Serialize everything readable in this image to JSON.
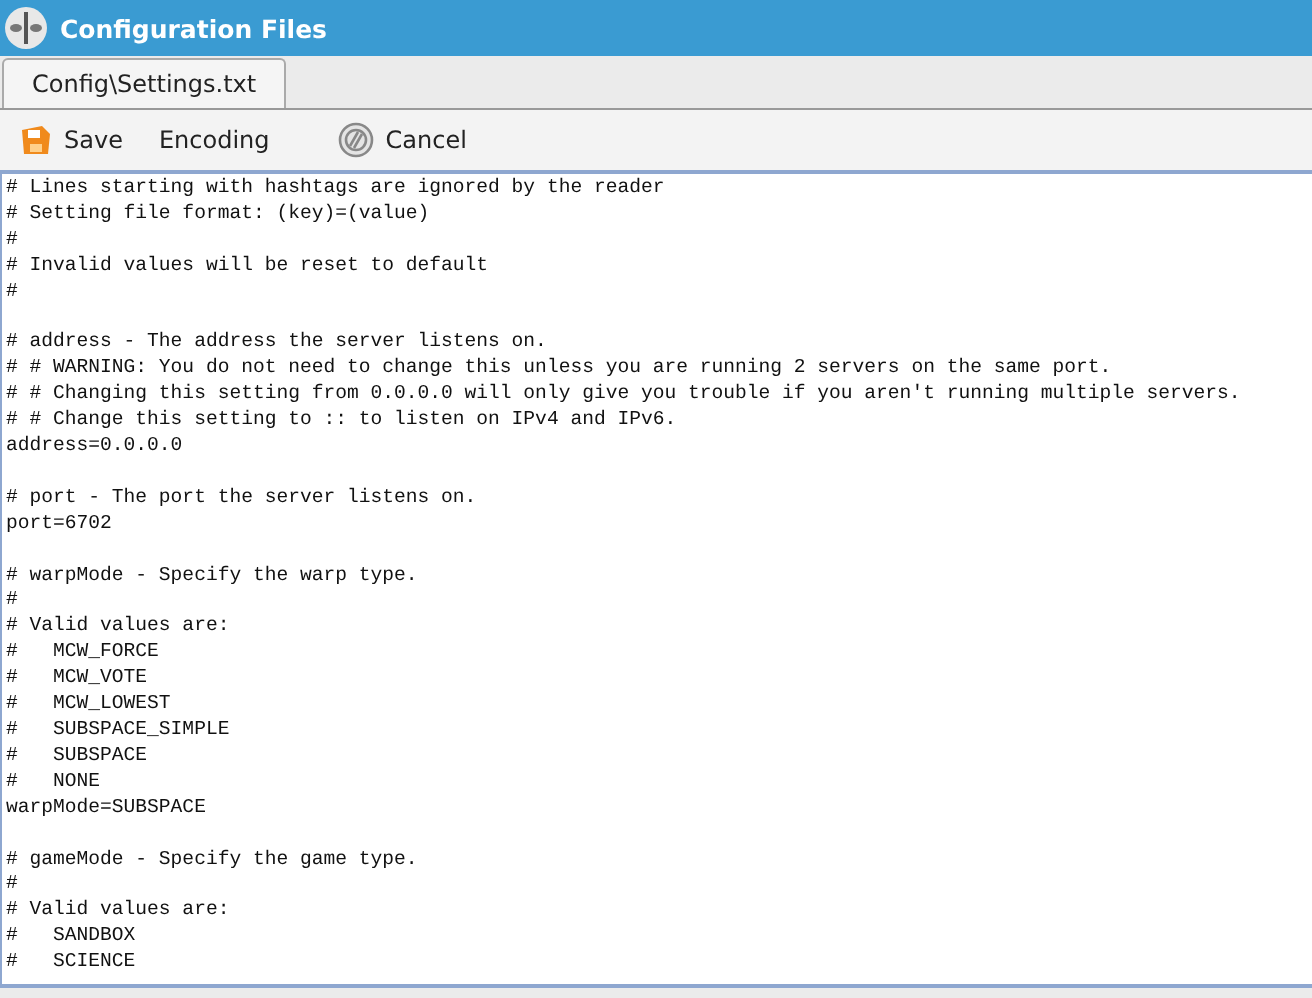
{
  "window": {
    "title": "Configuration Files"
  },
  "tabs": [
    {
      "label": "Config\\Settings.txt",
      "selected": true
    }
  ],
  "toolbar": [
    {
      "kind": "save",
      "label": "Save"
    },
    {
      "kind": "plain",
      "label": "Encoding"
    },
    {
      "kind": "cancel",
      "label": "Cancel"
    }
  ],
  "editor": {
    "blocks": [
      {
        "lines": [
          "# Lines starting with hashtags are ignored by the reader",
          "# Setting file format: (key)=(value)",
          "#",
          "# Invalid values will be reset to default",
          "#"
        ]
      },
      {
        "lines": [
          "# address - The address the server listens on.",
          "# # WARNING: You do not need to change this unless you are running 2 servers on the same port.",
          "# # Changing this setting from 0.0.0.0 will only give you trouble if you aren't running multiple servers.",
          "# # Change this setting to :: to listen on IPv4 and IPv6.",
          "address=0.0.0.0"
        ]
      },
      {
        "lines": [
          "# port - The port the server listens on.",
          "port=6702"
        ]
      },
      {
        "lines": [
          "# warpMode - Specify the warp type.",
          "#",
          "# Valid values are:",
          "#   MCW_FORCE",
          "#   MCW_VOTE",
          "#   MCW_LOWEST",
          "#   SUBSPACE_SIMPLE",
          "#   SUBSPACE",
          "#   NONE",
          "warpMode=SUBSPACE"
        ]
      },
      {
        "lines": [
          "# gameMode - Specify the game type.",
          "#",
          "# Valid values are:",
          "#   SANDBOX",
          "#   SCIENCE"
        ]
      }
    ]
  }
}
